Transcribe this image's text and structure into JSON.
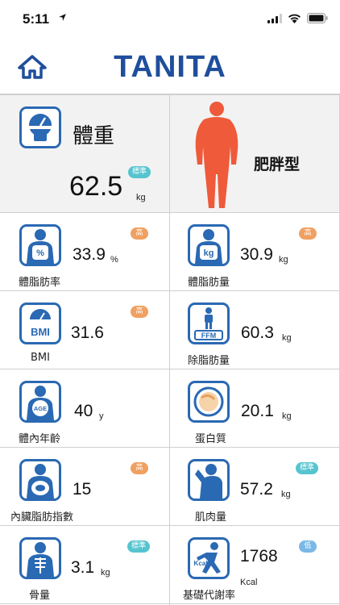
{
  "status_bar": {
    "time": "5:11"
  },
  "header": {
    "brand": "TANITA"
  },
  "weight": {
    "label": "體重",
    "value": "62.5",
    "unit": "kg",
    "badge": "標準"
  },
  "body_type": {
    "label": "肥胖型"
  },
  "metrics": [
    {
      "id": "body-fat",
      "label": "體脂肪率",
      "value": "33.9",
      "unit": "%",
      "badge": "高",
      "badge_type": "high",
      "icon": "body-fat-percent-icon"
    },
    {
      "id": "fat-mass",
      "label": "體脂肪量",
      "value": "30.9",
      "unit": "kg",
      "badge": "高",
      "badge_type": "high",
      "icon": "fat-mass-kg-icon"
    },
    {
      "id": "bmi",
      "label": "BMI",
      "value": "31.6",
      "unit": "",
      "badge": "高",
      "badge_type": "high",
      "icon": "bmi-icon"
    },
    {
      "id": "ffm",
      "label": "除脂肪量",
      "value": "60.3",
      "unit": "kg",
      "badge": "",
      "badge_type": "",
      "icon": "ffm-icon"
    },
    {
      "id": "age",
      "label": "體內年齡",
      "value": "40",
      "unit": "y",
      "badge": "",
      "badge_type": "",
      "icon": "metabolic-age-icon"
    },
    {
      "id": "protein",
      "label": "蛋白質",
      "value": "20.1",
      "unit": "kg",
      "badge": "",
      "badge_type": "",
      "icon": "protein-icon"
    },
    {
      "id": "visceral",
      "label": "內臟脂肪指數",
      "value": "15",
      "unit": "",
      "badge": "高",
      "badge_type": "high",
      "icon": "visceral-fat-icon"
    },
    {
      "id": "muscle",
      "label": "肌肉量",
      "value": "57.2",
      "unit": "kg",
      "badge": "標準",
      "badge_type": "std",
      "icon": "muscle-mass-icon"
    },
    {
      "id": "bone",
      "label": "骨量",
      "value": "3.1",
      "unit": "kg",
      "badge": "標準",
      "badge_type": "std",
      "icon": "bone-mass-icon"
    },
    {
      "id": "bmr",
      "label": "基礎代謝率",
      "value": "1768",
      "unit": "Kcal",
      "badge": "低",
      "badge_type": "low",
      "icon": "basal-metabolism-icon"
    }
  ],
  "colors": {
    "accent": "#2a69b3",
    "brand": "#1f4e9c",
    "body_figure": "#ee5a3a",
    "badge_high": "#f0a061",
    "badge_standard": "#56c4cf",
    "badge_low": "#7ab8e6"
  }
}
